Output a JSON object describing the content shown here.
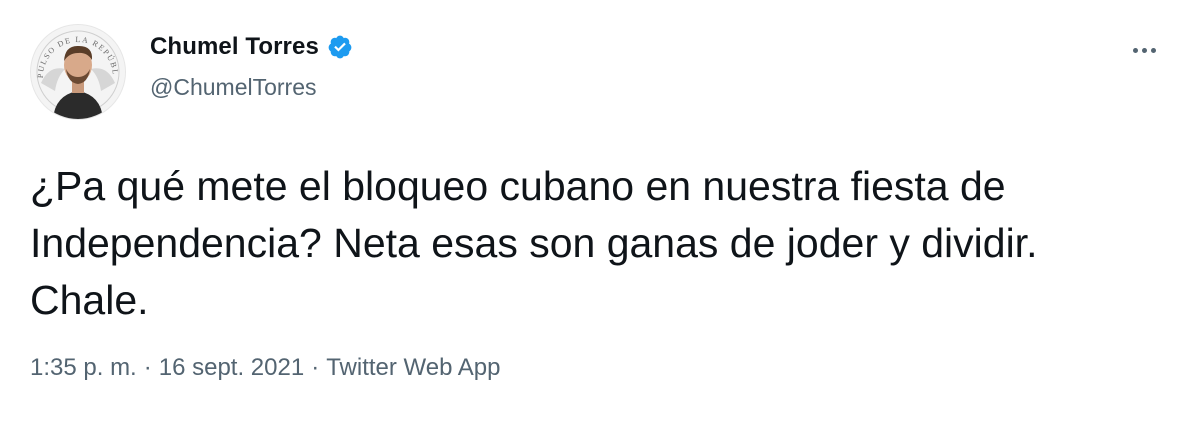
{
  "author": {
    "display_name": "Chumel Torres",
    "handle": "@ChumelTorres",
    "verified": true,
    "avatar_ring_text": "EL PULSO DE LA REPÚBLICA"
  },
  "tweet": {
    "text": "¿Pa qué mete el bloqueo cubano en nuestra fiesta de\nIndependencia? Neta esas son ganas de joder y dividir.\nChale.",
    "time": "1:35 p. m.",
    "date": "16 sept. 2021",
    "source": "Twitter Web App",
    "separator": "·"
  },
  "colors": {
    "text_primary": "#0f1419",
    "text_secondary": "#536471",
    "verified_blue": "#1d9bf0"
  },
  "icons": {
    "more": "more-horizontal-icon",
    "verified": "verified-badge-icon"
  }
}
